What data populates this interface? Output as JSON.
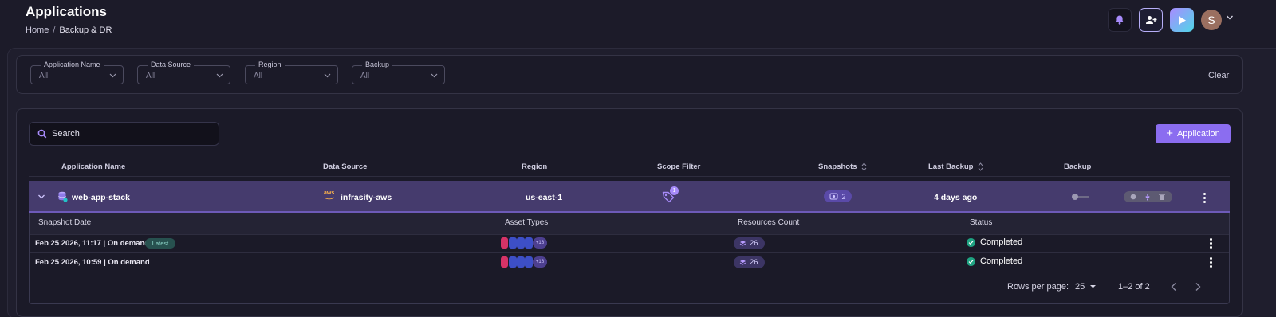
{
  "header": {
    "title": "Applications",
    "breadcrumb": {
      "home": "Home",
      "separator": "/",
      "current": "Backup & DR"
    },
    "avatar_initial": "S"
  },
  "filters": {
    "items": [
      {
        "label": "Application Name",
        "value": "All"
      },
      {
        "label": "Data Source",
        "value": "All"
      },
      {
        "label": "Region",
        "value": "All"
      },
      {
        "label": "Backup",
        "value": "All"
      }
    ],
    "clear_label": "Clear"
  },
  "toolbar": {
    "search_placeholder": "Search",
    "add_label": "Application"
  },
  "table": {
    "columns": {
      "name": "Application Name",
      "source": "Data Source",
      "region": "Region",
      "scope": "Scope Filter",
      "snapshots": "Snapshots",
      "last_backup": "Last Backup",
      "backup": "Backup"
    },
    "rows": [
      {
        "name": "web-app-stack",
        "source_logo": "aws",
        "source": "infrasity-aws",
        "region": "us-east-1",
        "scope_count": "1",
        "snapshots": "2",
        "last_backup": "4 days ago"
      }
    ]
  },
  "snapshots": {
    "columns": {
      "date": "Snapshot Date",
      "asset_types": "Asset Types",
      "resources": "Resources Count",
      "status": "Status"
    },
    "rows": [
      {
        "date": "Feb 25 2026, 11:17 | On demand",
        "badge": "Latest",
        "more": "+16",
        "resources": "26",
        "status": "Completed"
      },
      {
        "date": "Feb 25 2026, 10:59 | On demand",
        "badge": "",
        "more": "+16",
        "resources": "26",
        "status": "Completed"
      }
    ]
  },
  "pagination": {
    "rows_per_page_label": "Rows per page:",
    "rows_per_page": "25",
    "range": "1–2 of 2"
  },
  "colors": {
    "accent": "#8b6df0",
    "row_highlight": "#453b6d",
    "status_ok": "#1fa382"
  }
}
